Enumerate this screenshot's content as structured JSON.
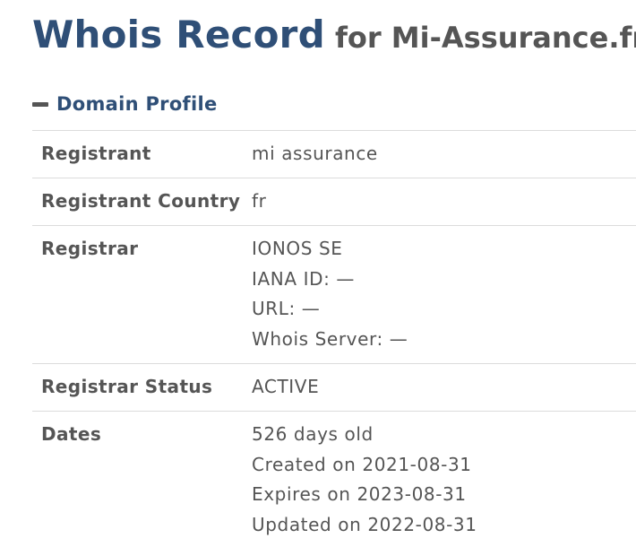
{
  "header": {
    "title_main": "Whois Record",
    "title_sub": "for Mi-Assurance.fr"
  },
  "section": {
    "icon": "minus-icon",
    "label": "Domain Profile"
  },
  "rows": [
    {
      "label": "Registrant",
      "values": [
        "mi assurance"
      ]
    },
    {
      "label": "Registrant Country",
      "values": [
        "fr"
      ]
    },
    {
      "label": "Registrar",
      "values": [
        "IONOS SE",
        "IANA ID: —",
        "URL: —",
        "Whois Server: —"
      ]
    },
    {
      "label": "Registrar Status",
      "values": [
        "ACTIVE"
      ]
    },
    {
      "label": "Dates",
      "values": [
        "526 days old",
        "Created on 2021-08-31",
        "Expires on 2023-08-31",
        "Updated on 2022-08-31"
      ]
    }
  ],
  "colors": {
    "heading": "#2f4f77",
    "text": "#555555",
    "divider": "#dcdcdc"
  }
}
